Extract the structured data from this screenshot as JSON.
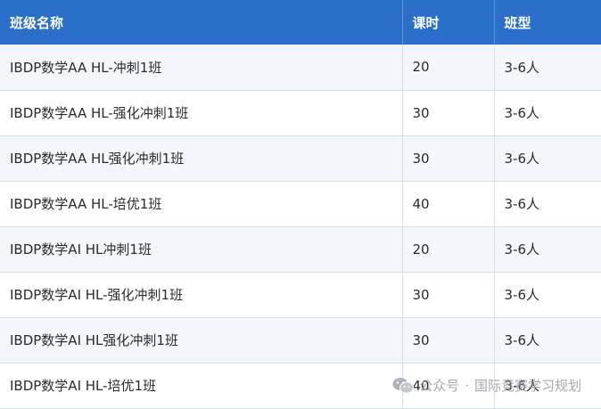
{
  "table": {
    "headers": [
      "班级名称",
      "课时",
      "班型"
    ],
    "rows": [
      [
        "IBDP数学AA HL-冲刺1班",
        "20",
        "3-6人"
      ],
      [
        "IBDP数学AA HL-强化冲刺1班",
        "30",
        "3-6人"
      ],
      [
        "IBDP数学AA HL强化冲刺1班",
        "30",
        "3-6人"
      ],
      [
        "IBDP数学AA HL-培优1班",
        "40",
        "3-6人"
      ],
      [
        "IBDP数学AI HL冲刺1班",
        "20",
        "3-6人"
      ],
      [
        "IBDP数学AI HL-强化冲刺1班",
        "30",
        "3-6人"
      ],
      [
        "IBDP数学AI HL强化冲刺1班",
        "30",
        "3-6人"
      ],
      [
        "IBDP数学AI HL-培优1班",
        "40",
        "3-6人"
      ]
    ]
  },
  "watermark": {
    "prefix": "公众号",
    "separator": "·",
    "account": "国际竞赛学习规划",
    "icon": "wechat-icon"
  },
  "colors": {
    "header_bg": "#2a6fc9",
    "row_alt_bg": "#f3f6fb"
  }
}
